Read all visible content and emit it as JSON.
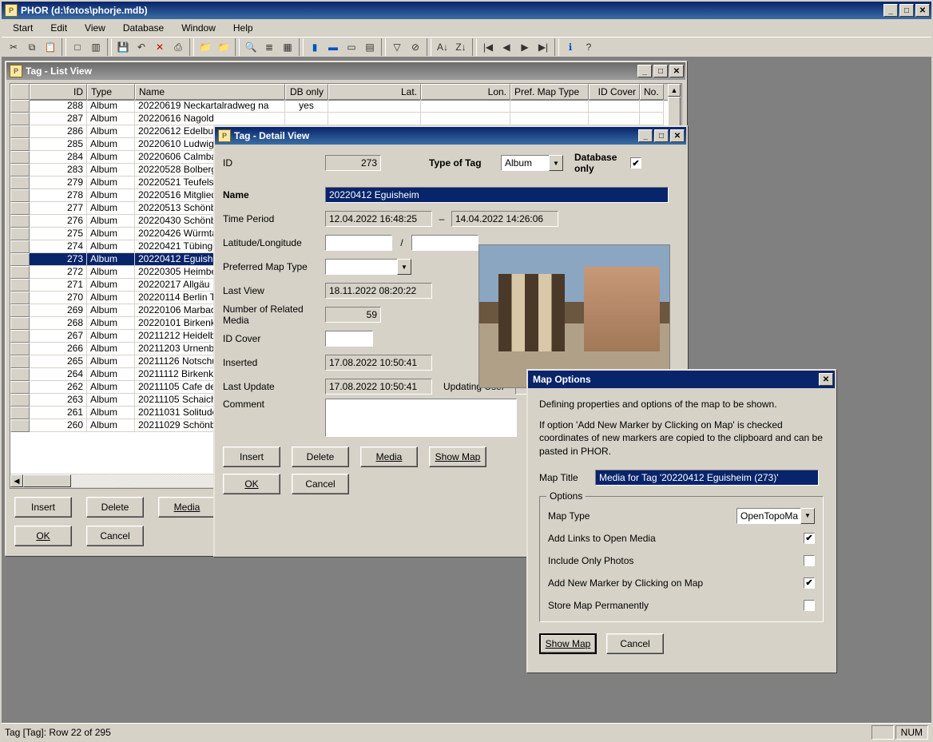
{
  "app": {
    "title": "PHOR (d:\\fotos\\phorje.mdb)"
  },
  "menu": [
    "Start",
    "Edit",
    "View",
    "Database",
    "Window",
    "Help"
  ],
  "tooltips": {
    "cut": "✂",
    "copy": "⧉",
    "paste": "📋",
    "new": "□",
    "open": "▥",
    "save": "💾",
    "undo": "↶",
    "delete": "✕",
    "print": "⎙",
    "folder": "📁",
    "find": "🔍",
    "list": "≣",
    "grid": "▦",
    "sel1": "▮",
    "sel2": "▬",
    "sel3": "▭",
    "sel4": "▤",
    "filter": "▽",
    "nofilter": "⊘",
    "sortA": "A↓",
    "sortZ": "Z↓",
    "navF": "|◀",
    "navP": "◀",
    "navN": "▶",
    "navL": "▶|",
    "info": "ℹ",
    "help": "?"
  },
  "list": {
    "title": "Tag - List View",
    "headers": [
      "",
      "ID",
      "Type",
      "Name",
      "DB only",
      "Lat.",
      "Lon.",
      "Pref. Map Type",
      "ID Cover",
      "No."
    ],
    "rows": [
      {
        "id": "288",
        "type": "Album",
        "name": "20220619 Neckartalradweg na",
        "db": "yes"
      },
      {
        "id": "287",
        "type": "Album",
        "name": "20220616 Nagold"
      },
      {
        "id": "286",
        "type": "Album",
        "name": "20220612 Edelbu"
      },
      {
        "id": "285",
        "type": "Album",
        "name": "20220610 Ludwigs"
      },
      {
        "id": "284",
        "type": "Album",
        "name": "20220606 Calmba"
      },
      {
        "id": "283",
        "type": "Album",
        "name": "20220528 Bolberg"
      },
      {
        "id": "279",
        "type": "Album",
        "name": "20220521 Teufels"
      },
      {
        "id": "278",
        "type": "Album",
        "name": "20220516 Mitglied"
      },
      {
        "id": "277",
        "type": "Album",
        "name": "20220513 Schönb"
      },
      {
        "id": "276",
        "type": "Album",
        "name": "20220430 Schönb"
      },
      {
        "id": "275",
        "type": "Album",
        "name": "20220426 Würmta"
      },
      {
        "id": "274",
        "type": "Album",
        "name": "20220421 Tübinge"
      },
      {
        "id": "273",
        "type": "Album",
        "name": "20220412 Eguishe",
        "sel": true
      },
      {
        "id": "272",
        "type": "Album",
        "name": "20220305 Heimbe"
      },
      {
        "id": "271",
        "type": "Album",
        "name": "20220217 Allgäu"
      },
      {
        "id": "270",
        "type": "Album",
        "name": "20220114 Berlin T"
      },
      {
        "id": "269",
        "type": "Album",
        "name": "20220106 Marbac"
      },
      {
        "id": "268",
        "type": "Album",
        "name": "20220101 Birkenk"
      },
      {
        "id": "267",
        "type": "Album",
        "name": "20211212 Heidelb"
      },
      {
        "id": "266",
        "type": "Album",
        "name": "20211203 Urnenb"
      },
      {
        "id": "265",
        "type": "Album",
        "name": "20211126 Notschu"
      },
      {
        "id": "264",
        "type": "Album",
        "name": "20211112 Birkenk"
      },
      {
        "id": "262",
        "type": "Album",
        "name": "20211105 Cafe de"
      },
      {
        "id": "263",
        "type": "Album",
        "name": "20211105 Schaich"
      },
      {
        "id": "261",
        "type": "Album",
        "name": "20211031 Solitude"
      },
      {
        "id": "260",
        "type": "Album",
        "name": "20211029 Schönb"
      }
    ],
    "buttons": {
      "insert": "Insert",
      "delete": "Delete",
      "media": "Media",
      "ok": "OK",
      "cancel": "Cancel"
    }
  },
  "detail": {
    "title": "Tag - Detail View",
    "labels": {
      "id": "ID",
      "type": "Type of Tag",
      "dbonly": "Database only",
      "name": "Name",
      "time": "Time Period",
      "latlon": "Latitude/Longitude",
      "pmt": "Preferred Map Type",
      "lastview": "Last View",
      "numrel": "Number of Related Media",
      "idcover": "ID Cover",
      "inserted": "Inserted",
      "lastupd": "Last Update",
      "upduser": "Updating User",
      "comment": "Comment"
    },
    "values": {
      "id": "273",
      "type": "Album",
      "dbonly": true,
      "name": "20220412 Eguisheim",
      "timefrom": "12.04.2022 16:48:25",
      "timesep": "—",
      "timeto": "14.04.2022 14:26:06",
      "lat": "",
      "slash": "/",
      "lon": "",
      "pmt": "",
      "lastview": "18.11.2022 08:20:22",
      "numrel": "59",
      "idcover": "",
      "inserted": "17.08.2022 10:50:41",
      "lastupd": "17.08.2022 10:50:41",
      "upduser": "",
      "comment": ""
    },
    "buttons": {
      "insert": "Insert",
      "delete": "Delete",
      "media": "Media",
      "showmap": "Show Map",
      "ok": "OK",
      "cancel": "Cancel"
    }
  },
  "map": {
    "title": "Map Options",
    "intro1": "Defining properties and options of the map to be shown.",
    "intro2": "If option 'Add New Marker by Clicking on Map' is checked coordinates of new markers are copied to the clipboard and can be pasted in PHOR.",
    "maptitle_label": "Map Title",
    "maptitle": "Media for Tag '20220412 Eguisheim (273)'",
    "groupTitle": "Options",
    "opts": {
      "maptype_label": "Map Type",
      "maptype": "OpenTopoMa",
      "links_label": "Add Links to Open Media",
      "links": true,
      "photos_label": "Include Only Photos",
      "photos": false,
      "marker_label": "Add New Marker by Clicking on Map",
      "marker": true,
      "store_label": "Store Map Permanently",
      "store": false
    },
    "buttons": {
      "showmap": "Show Map",
      "cancel": "Cancel"
    }
  },
  "status": {
    "text": "Tag [Tag]: Row 22 of 295",
    "num": "NUM"
  }
}
